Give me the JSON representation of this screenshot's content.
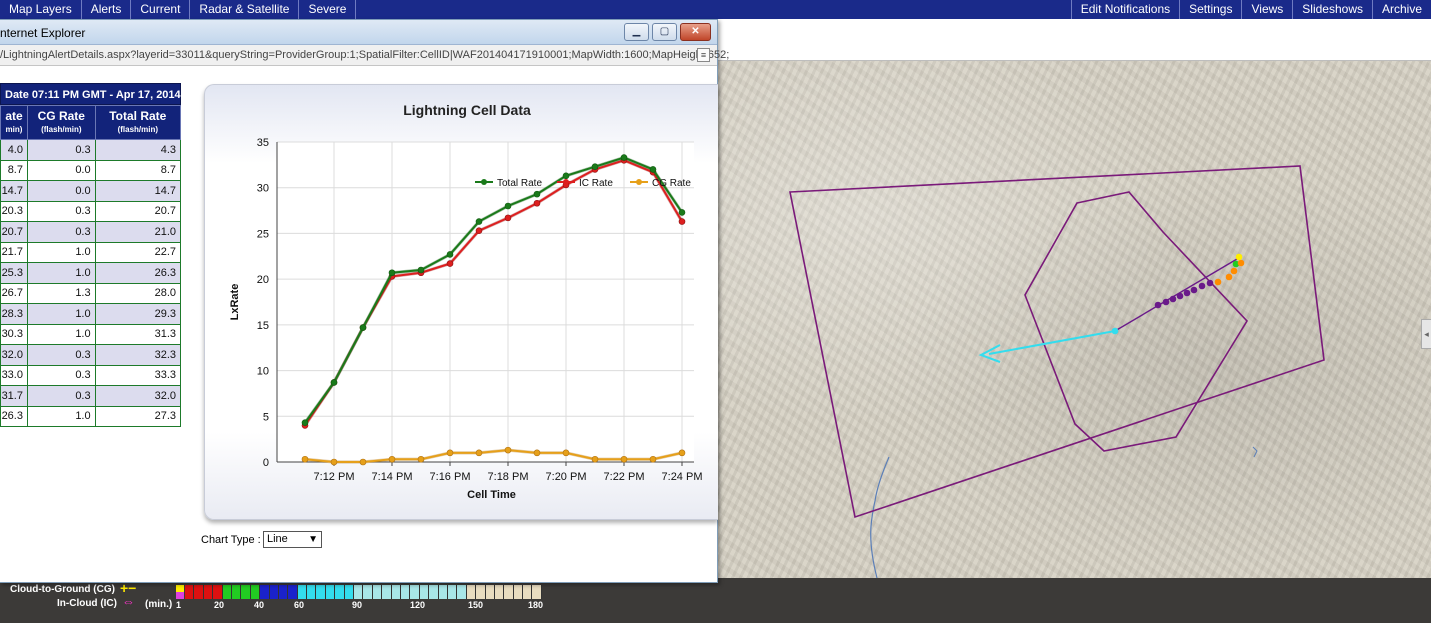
{
  "menu": {
    "left": [
      "Map Layers",
      "Alerts",
      "Current",
      "Radar & Satellite",
      "Severe"
    ],
    "right": [
      "Edit Notifications",
      "Settings",
      "Views",
      "Slideshows",
      "Archive"
    ]
  },
  "window": {
    "title": "nternet Explorer",
    "address": "/LightningAlertDetails.aspx?layerid=33011&queryString=ProviderGroup:1;SpatialFilter:CellID|WAF201404171910001;MapWidth:1600;MapHeight:652;",
    "min_label": "▁",
    "max_label": "▢",
    "close_label": "✕"
  },
  "table": {
    "date_header": "Date 07:11 PM GMT - Apr 17, 2014",
    "col1": {
      "name": "ate",
      "unit": "min)"
    },
    "col2": {
      "name": "CG Rate",
      "unit": "(flash/min)"
    },
    "col3": {
      "name": "Total Rate",
      "unit": "(flash/min)"
    },
    "rows": [
      [
        "4.0",
        "0.3",
        "4.3"
      ],
      [
        "8.7",
        "0.0",
        "8.7"
      ],
      [
        "14.7",
        "0.0",
        "14.7"
      ],
      [
        "20.3",
        "0.3",
        "20.7"
      ],
      [
        "20.7",
        "0.3",
        "21.0"
      ],
      [
        "21.7",
        "1.0",
        "22.7"
      ],
      [
        "25.3",
        "1.0",
        "26.3"
      ],
      [
        "26.7",
        "1.3",
        "28.0"
      ],
      [
        "28.3",
        "1.0",
        "29.3"
      ],
      [
        "30.3",
        "1.0",
        "31.3"
      ],
      [
        "32.0",
        "0.3",
        "32.3"
      ],
      [
        "33.0",
        "0.3",
        "33.3"
      ],
      [
        "31.7",
        "0.3",
        "32.0"
      ],
      [
        "26.3",
        "1.0",
        "27.3"
      ]
    ]
  },
  "chart_type": {
    "label": "Chart Type :",
    "value": "Line"
  },
  "chart_data": {
    "type": "line",
    "title": "Lightning Cell Data",
    "xlabel": "Cell Time",
    "ylabel": "LxRate",
    "ylim": [
      0,
      35
    ],
    "yticks": [
      0,
      5,
      10,
      15,
      20,
      25,
      30,
      35
    ],
    "x_tick_labels": [
      "7:12 PM",
      "7:14 PM",
      "7:16 PM",
      "7:18 PM",
      "7:20 PM",
      "7:22 PM",
      "7:24 PM"
    ],
    "x_tick_index": [
      1,
      3,
      5,
      7,
      9,
      11,
      13
    ],
    "grid": true,
    "legend": "top-right",
    "series": [
      {
        "name": "Total Rate",
        "color": "#1a7a1a",
        "values": [
          4.3,
          8.7,
          14.7,
          20.7,
          21.0,
          22.7,
          26.3,
          28.0,
          29.3,
          31.3,
          32.3,
          33.3,
          32.0,
          27.3
        ]
      },
      {
        "name": "IC Rate",
        "color": "#dd1f1f",
        "values": [
          4.0,
          8.7,
          14.7,
          20.3,
          20.7,
          21.7,
          25.3,
          26.7,
          28.3,
          30.3,
          32.0,
          33.0,
          31.7,
          26.3
        ]
      },
      {
        "name": "CG Rate",
        "color": "#e6a01a",
        "values": [
          0.3,
          0.0,
          0.0,
          0.3,
          0.3,
          1.0,
          1.0,
          1.3,
          1.0,
          1.0,
          0.3,
          0.3,
          0.3,
          1.0
        ]
      }
    ]
  },
  "legend": {
    "cg_label": "Cloud-to-Ground (CG)",
    "ic_label": "In-Cloud (IC)",
    "cg_symbol": "+−",
    "ic_symbol": "⇔",
    "min_label": "(min.)",
    "ticks": [
      "1",
      "20",
      "40",
      "60",
      "90",
      "120",
      "150",
      "180"
    ],
    "colors": {
      "red": "#dd1111",
      "green": "#22cc22",
      "blue": "#1a22cc",
      "cyan": "#33ddee",
      "paleblue": "#a8e6e8",
      "beige": "#e8dcc0"
    }
  },
  "map": {
    "colors": {
      "polygon": "#7a1a7a",
      "arrow": "#33ddee",
      "track": "#6a1a8a"
    },
    "right_tab": "◂"
  }
}
